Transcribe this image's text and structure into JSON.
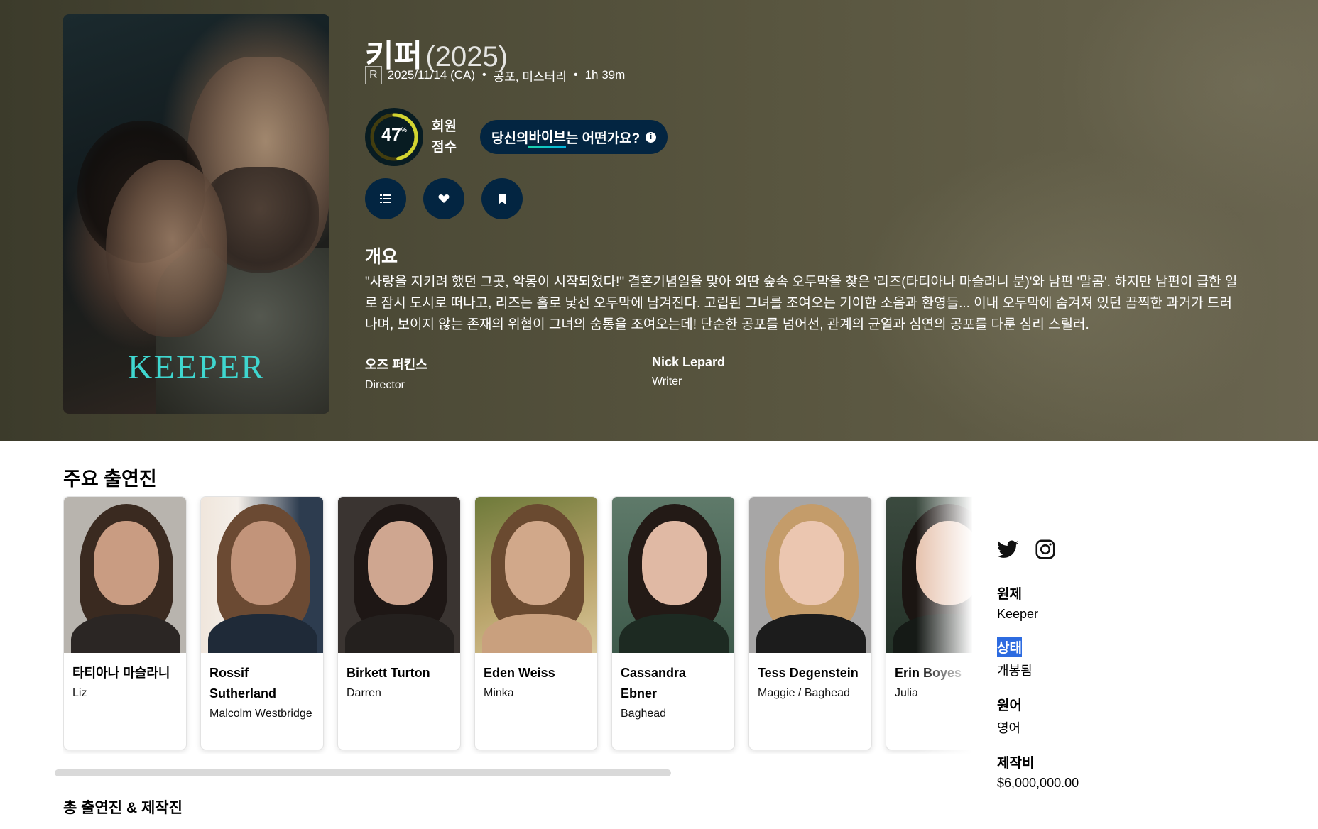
{
  "movie": {
    "title": "키퍼",
    "year": "(2025)",
    "certification": "R",
    "release": "2025/11/14 (CA)",
    "genres": "공포, 미스터리",
    "runtime": "1h 39m",
    "poster_logo": "KEEPER",
    "user_score": "47",
    "user_score_fraction": 0.47,
    "user_score_unit": "%",
    "score_label_line1": "회원",
    "score_label_line2": "점수",
    "vibe_prefix": "당신의 ",
    "vibe_highlight": "바이브",
    "vibe_suffix": "는 어떤가요?",
    "overview_heading": "개요",
    "overview": "\"사랑을 지키려 했던 그곳, 악몽이 시작되었다!\" 결혼기념일을 맞아 외딴 숲속 오두막을 찾은 '리즈(타티아나 마슬라니 분)'와 남편 '말콤'. 하지만 남편이 급한 일로 잠시 도시로 떠나고, 리즈는 홀로 낯선 오두막에 남겨진다. 고립된 그녀를 조여오는 기이한 소음과 환영들... 이내 오두막에 숨겨져 있던 끔찍한 과거가 드러나며, 보이지 않는 존재의 위협이 그녀의 숨통을 조여오는데! 단순한 공포를 넘어선, 관계의 균열과 심연의 공포를 다룬 심리 스릴러.",
    "crew": [
      {
        "name": "오즈 퍼킨스",
        "role": "Director"
      },
      {
        "name": "Nick Lepard",
        "role": "Writer"
      }
    ],
    "colors": {
      "score_ring": "#d2d531",
      "score_track": "#423d0f",
      "button_bg": "#032541"
    }
  },
  "cast_section": {
    "heading": "주요 출연진",
    "cast": [
      {
        "name": "타티아나 마슬라니",
        "role": "Liz"
      },
      {
        "name": "Rossif Sutherland",
        "role": "Malcolm Westbridge"
      },
      {
        "name": "Birkett Turton",
        "role": "Darren"
      },
      {
        "name": "Eden Weiss",
        "role": "Minka"
      },
      {
        "name": "Cassandra Ebner",
        "role": "Baghead"
      },
      {
        "name": "Tess Degenstein",
        "role": "Maggie / Baghead"
      },
      {
        "name": "Erin Boyes",
        "role": "Julia"
      }
    ],
    "full_link": "총 출연진 & 제작진"
  },
  "sidebar": {
    "socials": [
      "twitter-icon",
      "instagram-icon"
    ],
    "facts": [
      {
        "label": "원제",
        "value": "Keeper"
      },
      {
        "label": "상태",
        "value": "개봉됨"
      },
      {
        "label": "원어",
        "value": "영어"
      },
      {
        "label": "제작비",
        "value": "$6,000,000.00"
      }
    ]
  }
}
